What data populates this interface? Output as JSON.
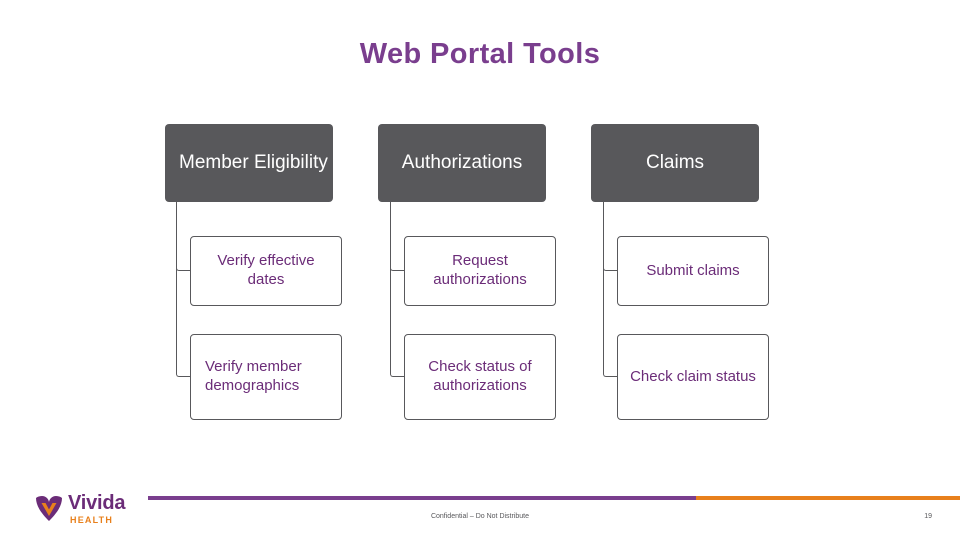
{
  "slide": {
    "title": "Web Portal Tools",
    "columns": [
      {
        "header": "Member Eligibility",
        "children": [
          "Verify effective dates",
          "Verify member demographics"
        ]
      },
      {
        "header": "Authorizations",
        "children": [
          "Request authorizations",
          "Check status of authorizations"
        ]
      },
      {
        "header": "Claims",
        "children": [
          "Submit claims",
          "Check claim status"
        ]
      }
    ]
  },
  "footer": {
    "confidential": "Confidential – Do Not Distribute",
    "slide_number": "19"
  },
  "logo": {
    "word": "Vivida",
    "sub": "HEALTH"
  },
  "colors": {
    "title_purple": "#7A3E8E",
    "node_gray": "#58585B",
    "text_purple": "#6B2C78",
    "accent_orange": "#E8801C"
  }
}
